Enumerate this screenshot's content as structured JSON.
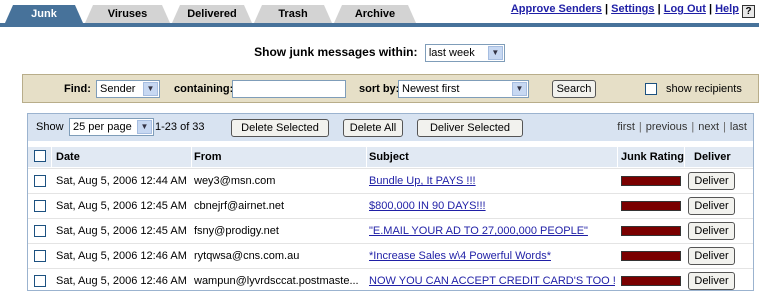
{
  "tabs": [
    {
      "label": "Junk",
      "active": true
    },
    {
      "label": "Viruses",
      "active": false
    },
    {
      "label": "Delivered",
      "active": false
    },
    {
      "label": "Trash",
      "active": false
    },
    {
      "label": "Archive",
      "active": false
    }
  ],
  "top_links": {
    "approve": "Approve Senders",
    "settings": "Settings",
    "logout": "Log Out",
    "help": "Help",
    "separator": "|",
    "help_icon": "?"
  },
  "show_within": {
    "label": "Show junk messages within:",
    "value": "last week"
  },
  "find": {
    "find_label": "Find:",
    "field_value": "Sender",
    "containing_label": "containing:",
    "query": "",
    "sort_label": "sort by:",
    "sort_value": "Newest first",
    "search_button": "Search",
    "show_recipients_label": "show recipients"
  },
  "toolbar": {
    "show_label": "Show",
    "page_size": "25 per page",
    "range": "1-23 of 33",
    "delete_selected": "Delete Selected",
    "delete_all": "Delete All",
    "deliver_selected": "Deliver Selected",
    "first": "first",
    "previous": "previous",
    "next": "next",
    "last": "last"
  },
  "columns": {
    "date": "Date",
    "from": "From",
    "subject": "Subject",
    "junk_rating": "Junk Rating",
    "deliver": "Deliver"
  },
  "rows": [
    {
      "date": "Sat, Aug 5, 2006 12:44 AM",
      "from": "wey3@msn.com",
      "subject": "Bundle Up, It PAYS !!!",
      "deliver": "Deliver"
    },
    {
      "date": "Sat, Aug 5, 2006 12:45 AM",
      "from": "cbnejrf@airnet.net",
      "subject": "$800,000 IN 90 DAYS!!!",
      "deliver": "Deliver"
    },
    {
      "date": "Sat, Aug 5, 2006 12:45 AM",
      "from": "fsny@prodigy.net",
      "subject": "\"E.MAIL YOUR AD TO 27,000,000 PEOPLE\"",
      "deliver": "Deliver"
    },
    {
      "date": "Sat, Aug 5, 2006 12:46 AM",
      "from": "rytqwsa@cns.com.au",
      "subject": "*Increase Sales w\\4 Powerful Words*",
      "deliver": "Deliver"
    },
    {
      "date": "Sat, Aug 5, 2006 12:46 AM",
      "from": "wampun@lyvrdsccat.postmaste...",
      "subject": "NOW YOU CAN ACCEPT CREDIT CARD'S TOO ! ! ! !",
      "deliver": "Deliver"
    }
  ],
  "colors": {
    "accent": "#47729a",
    "link": "#1f1fa6",
    "rating_bar": "#7a0000",
    "find_bar_bg": "#e6dfc7",
    "toolbar_bg": "#d8e3f1"
  },
  "icons": {
    "dropdown": "chevron-down-icon",
    "help": "help-icon"
  }
}
